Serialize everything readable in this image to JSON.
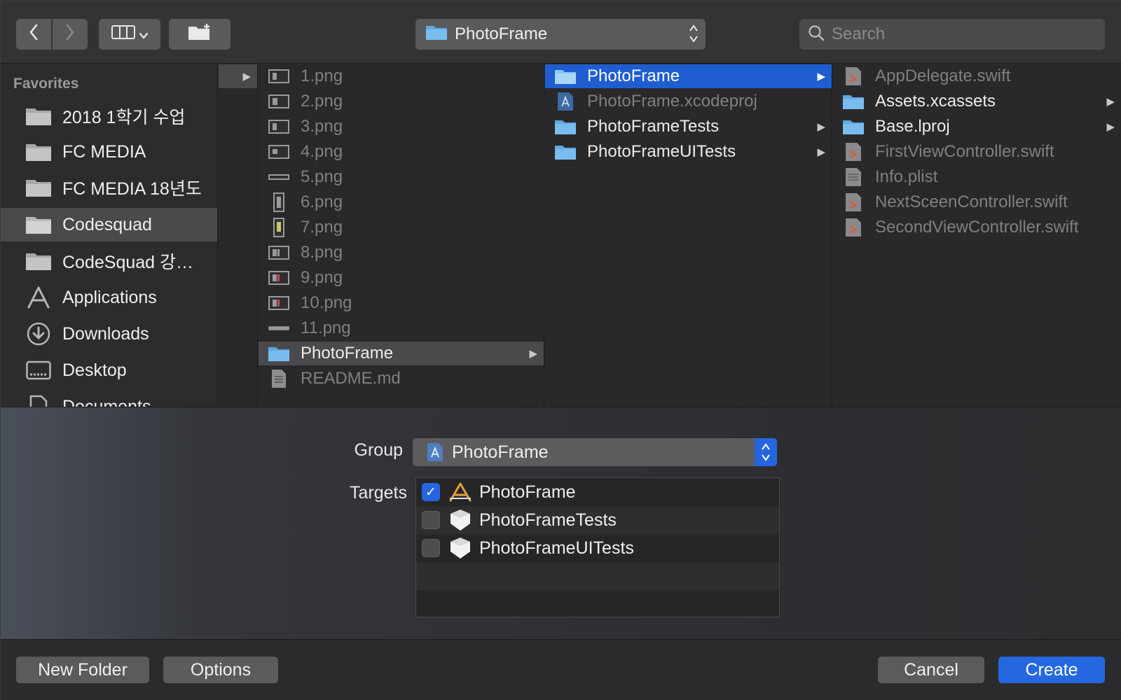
{
  "toolbar": {
    "back_glyph": "‹",
    "forward_glyph": "›",
    "view_glyph": "▥",
    "location": "PhotoFrame",
    "search_placeholder": "Search"
  },
  "sidebar": {
    "header": "Favorites",
    "items": [
      {
        "label": "2018 1학기 수업",
        "icon": "folder-icon"
      },
      {
        "label": "FC MEDIA",
        "icon": "folder-icon"
      },
      {
        "label": "FC MEDIA 18년도",
        "icon": "folder-icon"
      },
      {
        "label": "Codesquad",
        "icon": "folder-icon",
        "selected": true
      },
      {
        "label": "CodeSquad 강…",
        "icon": "folder-icon"
      },
      {
        "label": "Applications",
        "icon": "applications-icon"
      },
      {
        "label": "Downloads",
        "icon": "downloads-icon"
      },
      {
        "label": "Desktop",
        "icon": "desktop-icon"
      },
      {
        "label": "Documents",
        "icon": "documents-icon"
      }
    ]
  },
  "column2": {
    "items": [
      {
        "label": "1.png"
      },
      {
        "label": "2.png"
      },
      {
        "label": "3.png"
      },
      {
        "label": "4.png"
      },
      {
        "label": "5.png"
      },
      {
        "label": "6.png"
      },
      {
        "label": "7.png"
      },
      {
        "label": "8.png"
      },
      {
        "label": "9.png"
      },
      {
        "label": "10.png"
      },
      {
        "label": "11.png"
      },
      {
        "label": "PhotoFrame"
      },
      {
        "label": "README.md"
      }
    ]
  },
  "column3": {
    "items": [
      {
        "label": "PhotoFrame"
      },
      {
        "label": "PhotoFrame.xcodeproj"
      },
      {
        "label": "PhotoFrameTests"
      },
      {
        "label": "PhotoFrameUITests"
      }
    ]
  },
  "column4": {
    "items": [
      {
        "label": "AppDelegate.swift"
      },
      {
        "label": "Assets.xcassets"
      },
      {
        "label": "Base.lproj"
      },
      {
        "label": "FirstViewController.swift"
      },
      {
        "label": "Info.plist"
      },
      {
        "label": "NextSceenController.swift"
      },
      {
        "label": "SecondViewController.swift"
      }
    ]
  },
  "options": {
    "group_label": "Group",
    "group_value": "PhotoFrame",
    "targets_label": "Targets",
    "targets": [
      {
        "label": "PhotoFrame",
        "checked": true
      },
      {
        "label": "PhotoFrameTests",
        "checked": false
      },
      {
        "label": "PhotoFrameUITests",
        "checked": false
      }
    ]
  },
  "footer": {
    "new_folder": "New Folder",
    "options": "Options",
    "cancel": "Cancel",
    "create": "Create"
  },
  "colors": {
    "accent": "#2567e0",
    "selection_grey": "#4a4a4d",
    "background": "#2b2b2d"
  }
}
